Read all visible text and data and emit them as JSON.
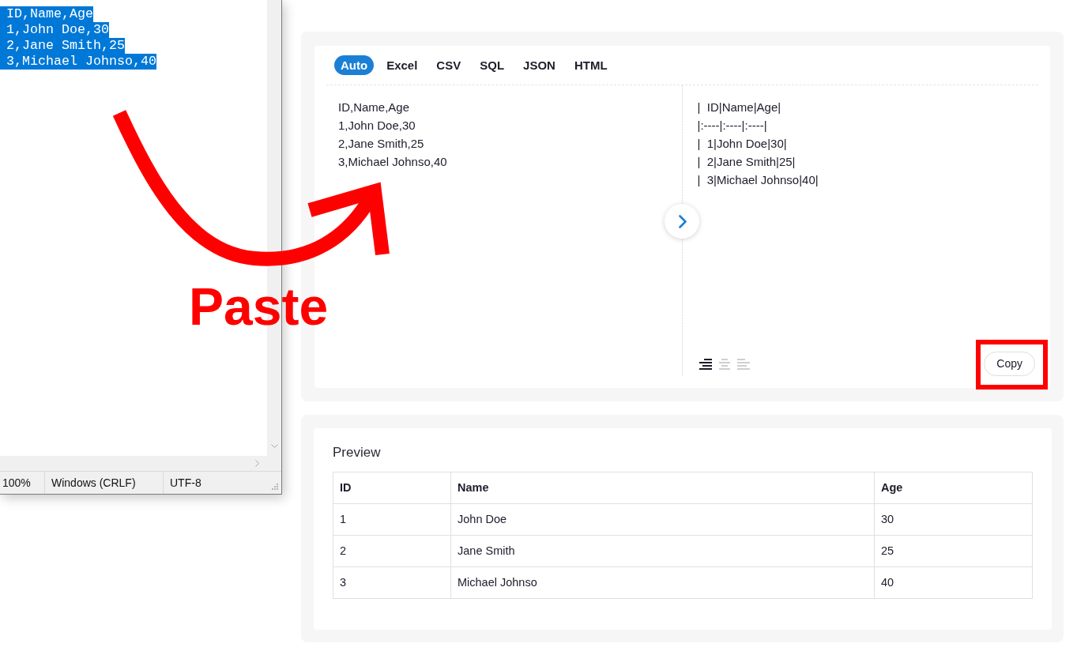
{
  "notepad": {
    "lines": [
      {
        "text": "ID,Name,Age",
        "selected": true
      },
      {
        "text": "1,John Doe,30",
        "selected": true
      },
      {
        "text": "2,Jane Smith,25",
        "selected": true
      },
      {
        "text": "3,Michael Johnso,40",
        "selected": true
      }
    ],
    "status_bar": {
      "zoom": "100%",
      "line_ending": "Windows (CRLF)",
      "encoding": "UTF-8"
    }
  },
  "converter": {
    "tabs": [
      {
        "label": "Auto",
        "selected": true
      },
      {
        "label": "Excel",
        "selected": false
      },
      {
        "label": "CSV",
        "selected": false
      },
      {
        "label": "SQL",
        "selected": false
      },
      {
        "label": "JSON",
        "selected": false
      },
      {
        "label": "HTML",
        "selected": false
      }
    ],
    "input_lines": [
      "ID,Name,Age",
      "1,John Doe,30",
      "2,Jane Smith,25",
      "3,Michael Johnso,40"
    ],
    "output_lines": [
      "|  ID|Name|Age|",
      "|:----|:----|:----|",
      "|  1|John Doe|30|",
      "|  2|Jane Smith|25|",
      "|  3|Michael Johnso|40|"
    ],
    "alignment_buttons": [
      {
        "kind": "right",
        "selected": true
      },
      {
        "kind": "center",
        "selected": false
      },
      {
        "kind": "left",
        "selected": false
      }
    ],
    "copy_button": {
      "label": "Copy",
      "highlighted": true
    }
  },
  "preview": {
    "title": "Preview",
    "columns": [
      "ID",
      "Name",
      "Age"
    ],
    "rows": [
      [
        "1",
        "John Doe",
        "30"
      ],
      [
        "2",
        "Jane Smith",
        "25"
      ],
      [
        "3",
        "Michael Johnso",
        "40"
      ]
    ]
  },
  "annotations": [
    {
      "kind": "arrow"
    },
    {
      "kind": "label",
      "text": "Paste"
    }
  ]
}
